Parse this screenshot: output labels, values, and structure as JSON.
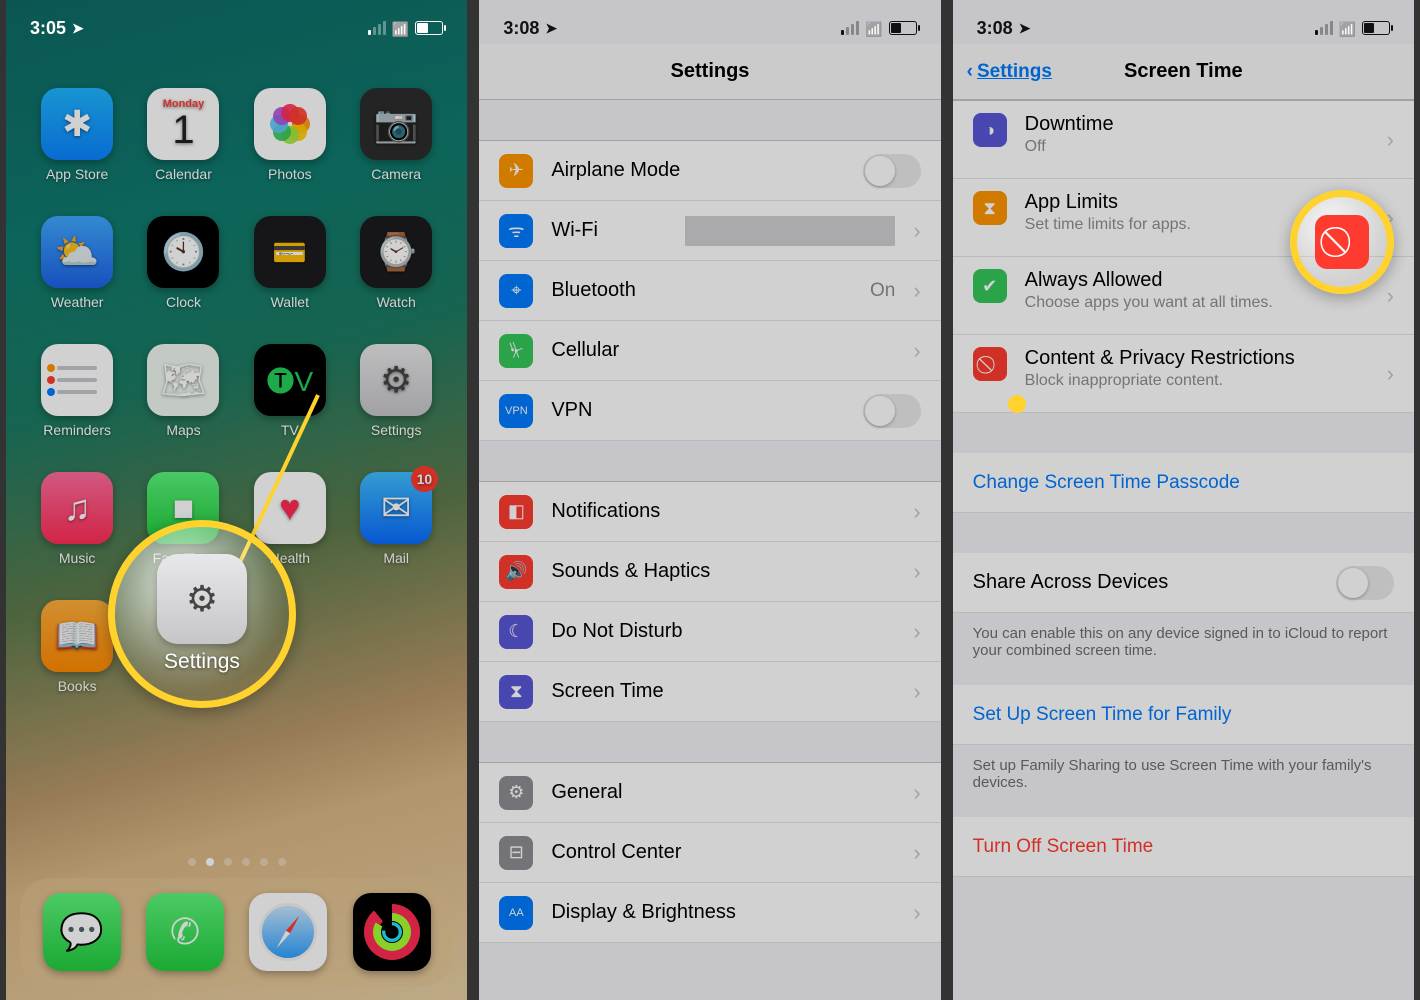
{
  "phone1": {
    "time": "3:05",
    "apps": [
      {
        "label": "App Store",
        "icn": "i-appstore",
        "name": "appstore-app"
      },
      {
        "label": "Calendar",
        "icn": "i-calendar",
        "name": "calendar-app",
        "day": "Monday",
        "num": "1"
      },
      {
        "label": "Photos",
        "icn": "i-photos",
        "name": "photos-app"
      },
      {
        "label": "Camera",
        "icn": "i-camera",
        "name": "camera-app"
      },
      {
        "label": "Weather",
        "icn": "i-weather",
        "name": "weather-app"
      },
      {
        "label": "Clock",
        "icn": "i-clock",
        "name": "clock-app"
      },
      {
        "label": "Wallet",
        "icn": "i-wallet",
        "name": "wallet-app"
      },
      {
        "label": "Watch",
        "icn": "i-watch",
        "name": "watch-app"
      },
      {
        "label": "Reminders",
        "icn": "i-reminders",
        "name": "reminders-app"
      },
      {
        "label": "Maps",
        "icn": "i-maps",
        "name": "maps-app"
      },
      {
        "label": "TV",
        "icn": "i-tv",
        "name": "tv-app"
      },
      {
        "label": "Settings",
        "icn": "i-settings",
        "name": "settings-app"
      },
      {
        "label": "Music",
        "icn": "i-music",
        "name": "music-app"
      },
      {
        "label": "FaceTime",
        "icn": "i-facetime",
        "name": "facetime-app"
      },
      {
        "label": "Health",
        "icn": "i-health",
        "name": "health-app"
      },
      {
        "label": "Mail",
        "icn": "i-mail",
        "name": "mail-app",
        "badge": "10"
      },
      {
        "label": "Books",
        "icn": "i-books",
        "name": "books-app"
      }
    ],
    "dock": [
      {
        "name": "messages-app",
        "icn": "i-msg"
      },
      {
        "name": "phone-app",
        "icn": "i-phone"
      },
      {
        "name": "safari-app",
        "icn": "i-safari"
      },
      {
        "name": "activity-app",
        "icn": "i-act"
      }
    ],
    "callout_label": "Settings"
  },
  "phone2": {
    "time": "3:08",
    "header": "Settings",
    "group1": [
      {
        "name": "airplane-mode-row",
        "icn": "c-orange",
        "glyph": "✈",
        "label": "Airplane Mode",
        "toggle": false
      },
      {
        "name": "wifi-row",
        "icn": "c-blue",
        "glyph": "ᯤ",
        "label": "Wi-Fi",
        "value": "",
        "chev": true
      },
      {
        "name": "bluetooth-row",
        "icn": "c-blue",
        "glyph": "⌖",
        "label": "Bluetooth",
        "value": "On",
        "chev": true
      },
      {
        "name": "cellular-row",
        "icn": "c-green",
        "glyph": "⏧",
        "label": "Cellular",
        "chev": true
      },
      {
        "name": "vpn-row",
        "icn": "c-blue",
        "glyph": "VPN",
        "label": "VPN",
        "toggle": false,
        "small": true
      }
    ],
    "group2": [
      {
        "name": "notifications-row",
        "icn": "c-red",
        "glyph": "◧",
        "label": "Notifications",
        "chev": true
      },
      {
        "name": "sounds-row",
        "icn": "c-red",
        "glyph": "🔊",
        "label": "Sounds & Haptics",
        "chev": true
      },
      {
        "name": "dnd-row",
        "icn": "c-purple",
        "glyph": "☾",
        "label": "Do Not Disturb",
        "chev": true
      },
      {
        "name": "screentime-row",
        "icn": "c-purple",
        "glyph": "⧗",
        "label": "Screen Time",
        "chev": true
      }
    ],
    "group3": [
      {
        "name": "general-row",
        "icn": "c-grey",
        "glyph": "⚙",
        "label": "General",
        "chev": true
      },
      {
        "name": "controlcenter-row",
        "icn": "c-grey",
        "glyph": "⊟",
        "label": "Control Center",
        "chev": true
      },
      {
        "name": "display-row",
        "icn": "c-blue",
        "glyph": "AA",
        "label": "Display & Brightness",
        "chev": true,
        "small": true
      }
    ]
  },
  "phone3": {
    "time": "3:08",
    "back": "Settings",
    "title": "Screen Time",
    "rows": [
      {
        "name": "downtime-row",
        "icn": "c-purple",
        "glyph": "◑",
        "title": "Downtime",
        "sub": "Off"
      },
      {
        "name": "applimits-row",
        "icn": "c-orange",
        "glyph": "⧗",
        "title": "App Limits",
        "sub": "Set time limits for apps."
      },
      {
        "name": "allowed-row",
        "icn": "c-green2",
        "glyph": "✔",
        "title": "Always Allowed",
        "sub": "Choose apps you want at all times."
      },
      {
        "name": "content-row",
        "icn": "c-red",
        "glyph": "⃠",
        "title": "Content & Privacy Restrictions",
        "sub": "Block inappropriate content."
      }
    ],
    "change_passcode": "Change Screen Time Passcode",
    "share_across": "Share Across Devices",
    "share_note": "You can enable this on any device signed in to iCloud to report your combined screen time.",
    "family": "Set Up Screen Time for Family",
    "family_note": "Set up Family Sharing to use Screen Time with your family's devices.",
    "turn_off": "Turn Off Screen Time"
  }
}
